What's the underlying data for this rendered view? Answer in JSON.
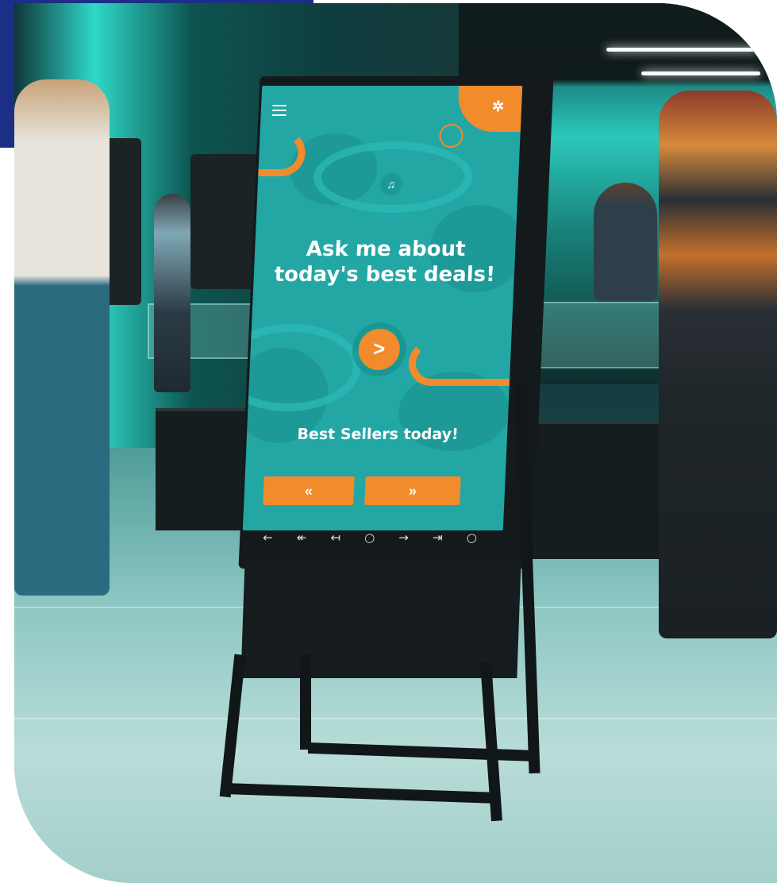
{
  "kiosk": {
    "headline": "Ask me about today's best deals!",
    "play_glyph": ">",
    "subheadline": "Best Sellers today!",
    "prev_glyph": "«",
    "next_glyph": "»",
    "menu_icon": "hamburger-menu-icon",
    "settings_glyph": "✲",
    "mic_glyph": "♫",
    "softkeys": [
      "←",
      "↞",
      "↤",
      "○",
      "→",
      "⇥",
      "○"
    ]
  },
  "colors": {
    "accent_navy": "#1c2f86",
    "screen_teal": "#22a7a5",
    "button_orange": "#f28b2c"
  }
}
